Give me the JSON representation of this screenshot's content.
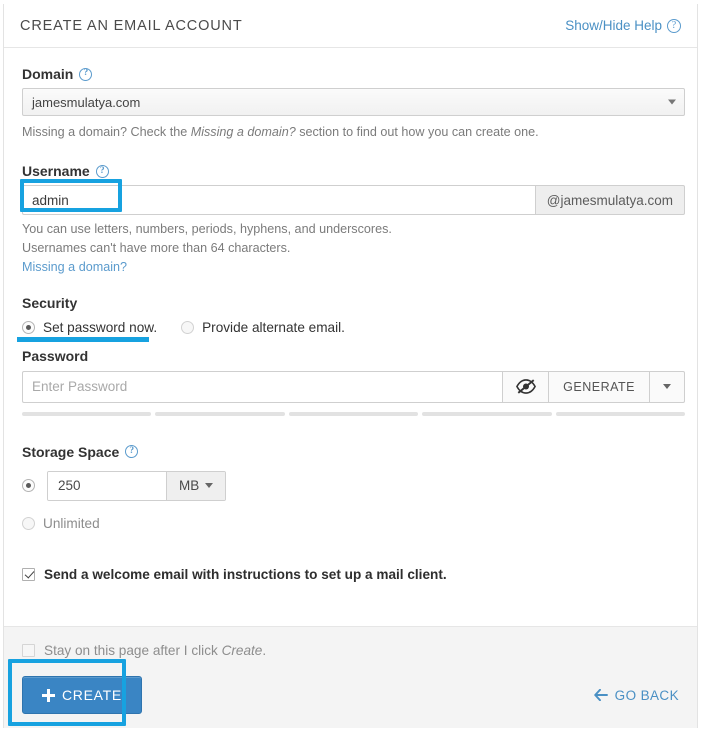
{
  "header": {
    "title": "CREATE AN EMAIL ACCOUNT",
    "help_label": "Show/Hide Help",
    "help_icon": "question-circle-icon"
  },
  "domain": {
    "label": "Domain",
    "help_icon": "question-circle-icon",
    "selected": "jamesmulatya.com",
    "caret_icon": "chevron-down-icon",
    "hint_before": "Missing a domain? Check the ",
    "hint_italic": "Missing a domain?",
    "hint_after": " section to find out how you can create one."
  },
  "username": {
    "label": "Username",
    "help_icon": "question-circle-icon",
    "value": "admin",
    "placeholder": "",
    "suffix": "@jamesmulatya.com",
    "hint_line1": "You can use letters, numbers, periods, hyphens, and underscores.",
    "hint_line2": "Usernames can't have more than 64 characters.",
    "link": "Missing a domain?"
  },
  "security": {
    "label": "Security",
    "options": [
      {
        "label": "Set password now.",
        "checked": true
      },
      {
        "label": "Provide alternate email.",
        "checked": false
      }
    ],
    "password_label": "Password",
    "password_value": "",
    "password_placeholder": "Enter Password",
    "eye_icon": "eye-slash-icon",
    "generate_label": "GENERATE",
    "generate_caret_icon": "chevron-down-icon",
    "strength_segments": 5
  },
  "storage": {
    "label": "Storage Space",
    "help_icon": "question-circle-icon",
    "quota_selected": true,
    "quota_value": "250",
    "unit": "MB",
    "unit_caret_icon": "chevron-down-icon",
    "unlimited_label": "Unlimited",
    "unlimited_selected": false
  },
  "options": {
    "welcome_email": {
      "label": "Send a welcome email with instructions to set up a mail client.",
      "checked": true
    },
    "stay_on_page": {
      "label_before": "Stay on this page after I click ",
      "label_italic": "Create",
      "label_after": ".",
      "checked": false
    }
  },
  "footer": {
    "create_label": "CREATE",
    "create_icon": "plus-icon",
    "go_back_label": "GO BACK",
    "go_back_icon": "arrow-left-icon"
  },
  "annotations": {
    "accent_color": "#17a2e0"
  }
}
